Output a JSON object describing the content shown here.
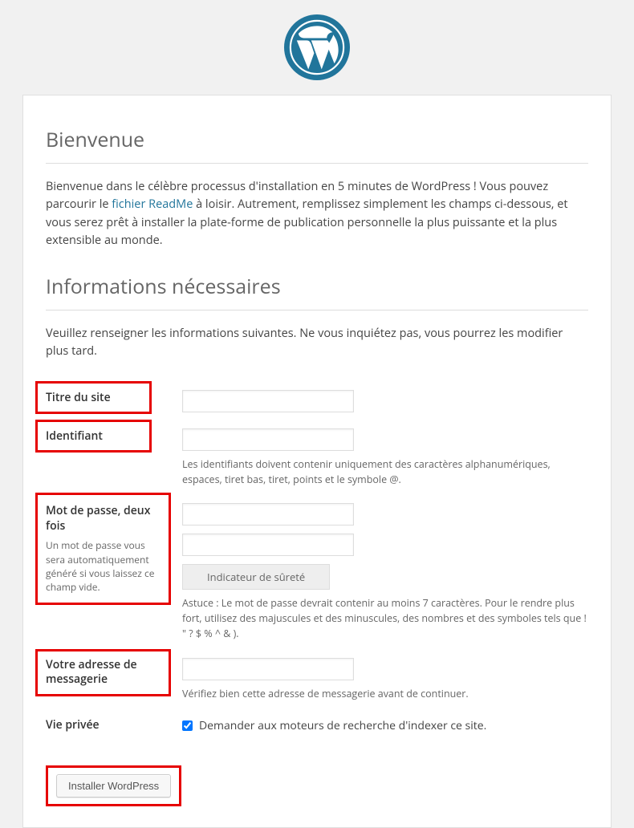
{
  "heading_welcome": "Bienvenue",
  "intro_before": "Bienvenue dans le célèbre processus d'installation en 5 minutes de WordPress ! Vous pouvez parcourir le ",
  "intro_link": "fichier ReadMe",
  "intro_after": " à loisir. Autrement, remplissez simplement les champs ci-dessous, et vous serez prêt à installer la plate-forme de publication personnelle la plus puissante et la plus extensible au monde.",
  "heading_info": "Informations nécessaires",
  "info_sub": "Veuillez renseigner les informations suivantes. Ne vous inquiétez pas, vous pourrez les modifier plus tard.",
  "fields": {
    "site_title_label": "Titre du site",
    "username_label": "Identifiant",
    "username_desc": "Les identifiants doivent contenir uniquement des caractères alphanumériques, espaces, tiret bas, tiret, points et le symbole @.",
    "password_label": "Mot de passe, deux fois",
    "password_sub": "Un mot de passe vous sera automatiquement généré si vous laissez ce champ vide.",
    "strength_indicator": "Indicateur de sûreté",
    "password_hint": "Astuce : Le mot de passe devrait contenir au moins 7 caractères. Pour le rendre plus fort, utilisez des majuscules et des minuscules, des nombres et des symboles tels que ! \" ? $ % ^ & ).",
    "email_label": "Votre adresse de messagerie",
    "email_desc": "Vérifiez bien cette adresse de messagerie avant de continuer.",
    "privacy_label": "Vie privée",
    "privacy_checkbox": "Demander aux moteurs de recherche d'indexer ce site.",
    "submit": "Installer WordPress"
  }
}
